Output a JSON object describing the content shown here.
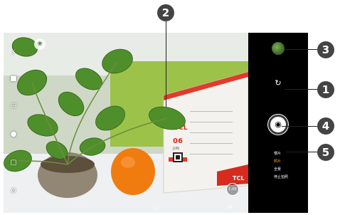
{
  "viewfinder": {
    "calendar_brand": "TCL",
    "calendar_day": "06",
    "calendar_month": "JUN",
    "calendar_brand_bottom": "TCL"
  },
  "left_toolbar": {
    "icons": [
      "flash-icon",
      "hdr-icon",
      "timer-icon",
      "person-icon",
      "aspect-ratio-icon",
      "settings-icon"
    ]
  },
  "overlay": {
    "filter_icon": "leaf-icon",
    "zoom_label": "1.0X"
  },
  "nav_bar": {
    "back": "‹",
    "home": "○",
    "recents": "≡"
  },
  "right_panel": {
    "switch_icon": "camera-switch-icon",
    "shutter_icon": "camera-icon",
    "modes": [
      {
        "label": "慢片",
        "active": false
      },
      {
        "label": "照片",
        "active": true
      },
      {
        "label": "全景",
        "active": false
      },
      {
        "label": "停止拍照",
        "active": false
      }
    ]
  },
  "callouts": {
    "n1": "1",
    "n2": "2",
    "n3": "3",
    "n4": "4",
    "n5": "5"
  }
}
